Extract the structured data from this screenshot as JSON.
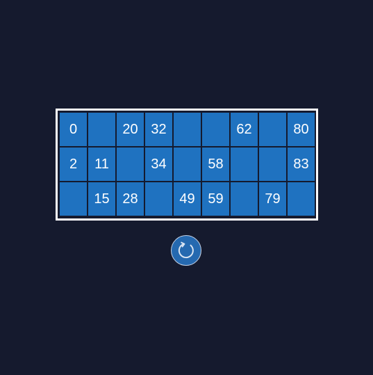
{
  "ticket": {
    "rows": [
      [
        "0",
        "",
        "20",
        "32",
        "",
        "",
        "62",
        "",
        "80"
      ],
      [
        "2",
        "11",
        "",
        "34",
        "",
        "58",
        "",
        "",
        "83"
      ],
      [
        "",
        "15",
        "28",
        "",
        "49",
        "59",
        "",
        "79",
        ""
      ]
    ]
  },
  "reset_button": {
    "icon": "refresh-icon"
  },
  "colors": {
    "background": "#151a2e",
    "cell": "#1f72c0",
    "border": "#ffffff",
    "text": "#ffffff"
  }
}
